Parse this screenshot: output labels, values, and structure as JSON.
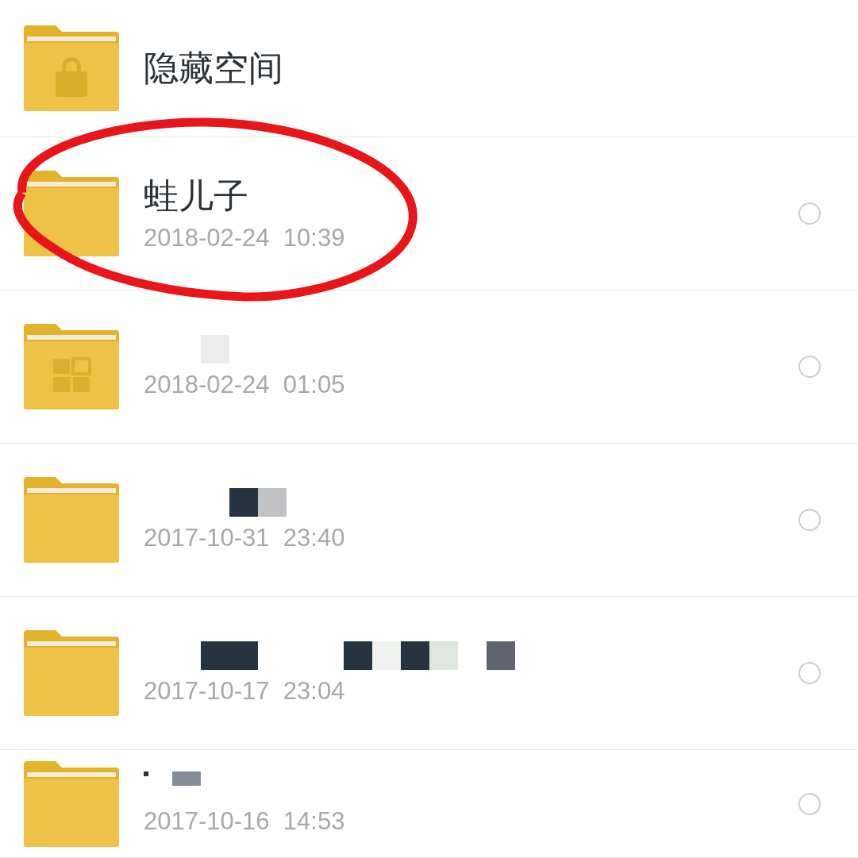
{
  "items": [
    {
      "kind": "space",
      "name": "隐藏空间"
    },
    {
      "kind": "folder",
      "name": "蛙儿子",
      "date": "2018-02-24  10:39",
      "selected": false
    },
    {
      "kind": "folder",
      "date": "2018-02-24  01:05",
      "selected": false
    },
    {
      "kind": "folder",
      "date": "2017-10-31  23:40",
      "selected": false
    },
    {
      "kind": "folder",
      "date": "2017-10-17  23:04",
      "selected": false
    },
    {
      "kind": "folder",
      "date": "2017-10-16  14:53",
      "selected": false
    }
  ]
}
